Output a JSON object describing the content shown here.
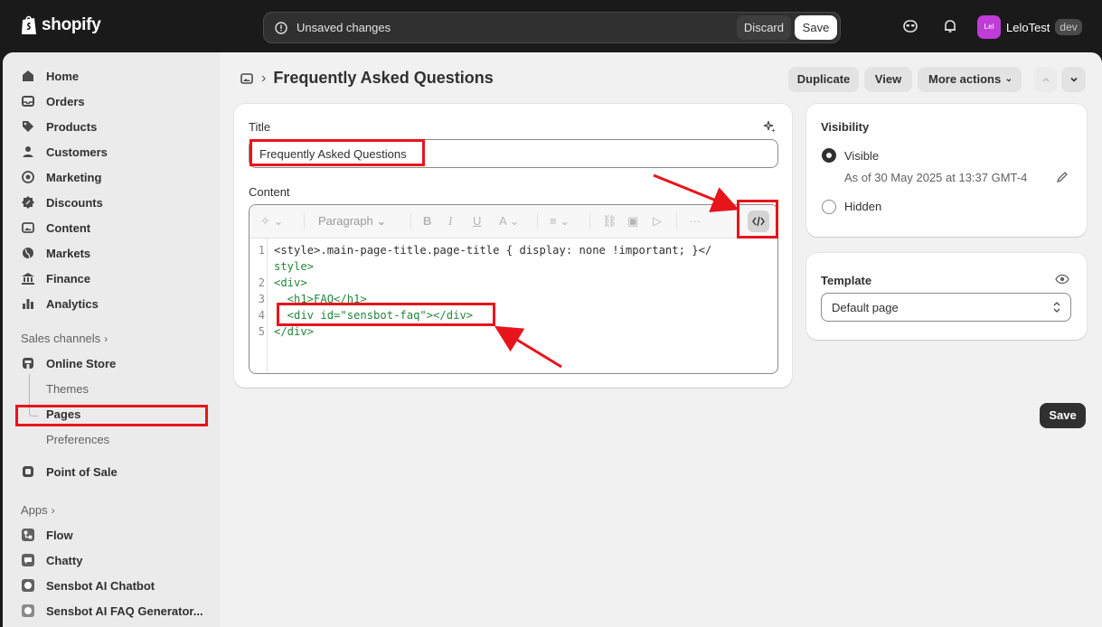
{
  "topbar": {
    "logo_text": "shopify",
    "unsaved_text": "Unsaved changes",
    "discard_label": "Discard",
    "save_label": "Save",
    "user_initials": "Lel",
    "user_name": "LeloTest",
    "user_badge": "dev"
  },
  "sidebar": {
    "items": [
      {
        "label": "Home",
        "icon": "home-icon"
      },
      {
        "label": "Orders",
        "icon": "inbox-icon"
      },
      {
        "label": "Products",
        "icon": "tag-icon"
      },
      {
        "label": "Customers",
        "icon": "person-icon"
      },
      {
        "label": "Marketing",
        "icon": "target-icon"
      },
      {
        "label": "Discounts",
        "icon": "discount-icon"
      },
      {
        "label": "Content",
        "icon": "image-icon"
      },
      {
        "label": "Markets",
        "icon": "globe-icon"
      },
      {
        "label": "Finance",
        "icon": "bank-icon"
      },
      {
        "label": "Analytics",
        "icon": "chart-icon"
      }
    ],
    "sales_channels_label": "Sales channels",
    "online_store_label": "Online Store",
    "sub_items": [
      "Themes",
      "Pages",
      "Preferences"
    ],
    "point_of_sale_label": "Point of Sale",
    "apps_label": "Apps",
    "apps": [
      "Flow",
      "Chatty",
      "Sensbot AI Chatbot",
      "Sensbot AI FAQ Generator..."
    ]
  },
  "header": {
    "title": "Frequently Asked Questions",
    "duplicate_label": "Duplicate",
    "view_label": "View",
    "more_actions_label": "More actions"
  },
  "main": {
    "title_label": "Title",
    "title_value": "Frequently Asked Questions",
    "content_label": "Content",
    "paragraph_label": "Paragraph",
    "code_lines": [
      {
        "num": "1",
        "text": "<style>.main-page-title.page-title { display: none !important; }</"
      },
      {
        "num": "",
        "text": "style>"
      },
      {
        "num": "2",
        "text": "<div>"
      },
      {
        "num": "3",
        "text": "  <h1>FAQ</h1>"
      },
      {
        "num": "4",
        "text": "  <div id=\"sensbot-faq\"></div>"
      },
      {
        "num": "5",
        "text": "</div>"
      }
    ]
  },
  "visibility": {
    "heading": "Visibility",
    "visible_label": "Visible",
    "visible_date": "As of 30 May 2025 at 13:37 GMT-4",
    "hidden_label": "Hidden"
  },
  "template": {
    "heading": "Template",
    "selected": "Default page"
  },
  "footer": {
    "save_label": "Save"
  },
  "colors": {
    "topbar": "#1a1a1a",
    "annotation": "#e8141c",
    "avatar": "#c03cd6"
  }
}
